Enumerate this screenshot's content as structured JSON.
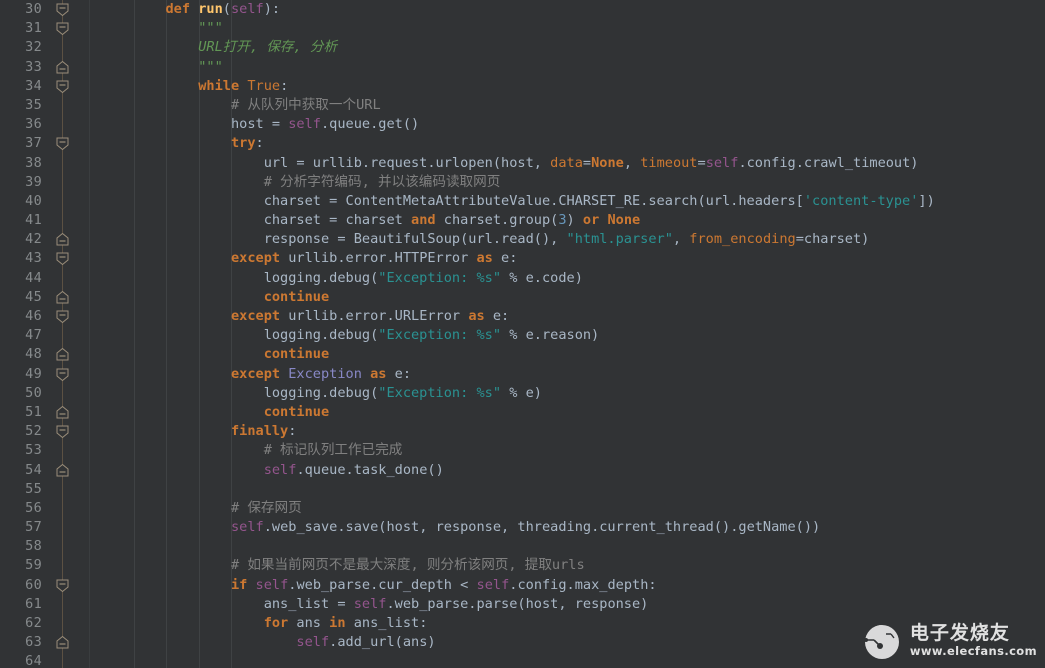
{
  "editor": {
    "language": "Python",
    "first_line_number": 30,
    "last_line_number": 64,
    "colors": {
      "background": "#313335",
      "gutter_background": "#313335",
      "line_number": "#868a8c",
      "default_text": "#a9b7c6",
      "keyword": "#cc7832",
      "function_name": "#ffc66d",
      "self_param": "#94558d",
      "string": "#2a9292",
      "number": "#6897bb",
      "comment": "#808080",
      "docstring": "#629755",
      "exception_class": "#8888c6",
      "fold_rail": "#5c5143",
      "indent_guide": "#3f4244"
    }
  },
  "lines": [
    {
      "n": 30,
      "fold": "start",
      "tokens": [
        {
          "t": "        ",
          "c": "plain"
        },
        {
          "t": "def",
          "c": "kw"
        },
        {
          "t": " ",
          "c": "plain"
        },
        {
          "t": "run",
          "c": "def"
        },
        {
          "t": "(",
          "c": "op"
        },
        {
          "t": "self",
          "c": "self"
        },
        {
          "t": "):",
          "c": "op"
        }
      ]
    },
    {
      "n": 31,
      "fold": "start",
      "tokens": [
        {
          "t": "            ",
          "c": "plain"
        },
        {
          "t": "\"\"\"",
          "c": "doc"
        }
      ]
    },
    {
      "n": 32,
      "fold": "none",
      "tokens": [
        {
          "t": "            ",
          "c": "plain"
        },
        {
          "t": "URL打开, 保存, 分析",
          "c": "doc"
        }
      ]
    },
    {
      "n": 33,
      "fold": "end",
      "tokens": [
        {
          "t": "            ",
          "c": "plain"
        },
        {
          "t": "\"\"\"",
          "c": "doc"
        }
      ]
    },
    {
      "n": 34,
      "fold": "start",
      "tokens": [
        {
          "t": "            ",
          "c": "plain"
        },
        {
          "t": "while",
          "c": "kw"
        },
        {
          "t": " ",
          "c": "plain"
        },
        {
          "t": "True",
          "c": "kw2"
        },
        {
          "t": ":",
          "c": "op"
        }
      ]
    },
    {
      "n": 35,
      "fold": "none",
      "tokens": [
        {
          "t": "                ",
          "c": "plain"
        },
        {
          "t": "# 从队列中获取一个URL",
          "c": "cmt"
        }
      ]
    },
    {
      "n": 36,
      "fold": "none",
      "tokens": [
        {
          "t": "                ",
          "c": "plain"
        },
        {
          "t": "host = ",
          "c": "plain"
        },
        {
          "t": "self",
          "c": "self"
        },
        {
          "t": ".queue.get()",
          "c": "plain"
        }
      ]
    },
    {
      "n": 37,
      "fold": "start",
      "tokens": [
        {
          "t": "                ",
          "c": "plain"
        },
        {
          "t": "try",
          "c": "kw"
        },
        {
          "t": ":",
          "c": "op"
        }
      ]
    },
    {
      "n": 38,
      "fold": "none",
      "tokens": [
        {
          "t": "                    ",
          "c": "plain"
        },
        {
          "t": "url = urllib.request.urlopen(host, ",
          "c": "plain"
        },
        {
          "t": "data",
          "c": "kw2"
        },
        {
          "t": "=",
          "c": "op"
        },
        {
          "t": "None",
          "c": "kw"
        },
        {
          "t": ", ",
          "c": "plain"
        },
        {
          "t": "timeout",
          "c": "kw2"
        },
        {
          "t": "=",
          "c": "op"
        },
        {
          "t": "self",
          "c": "self"
        },
        {
          "t": ".config.crawl_timeout)",
          "c": "plain"
        }
      ]
    },
    {
      "n": 39,
      "fold": "none",
      "tokens": [
        {
          "t": "                    ",
          "c": "plain"
        },
        {
          "t": "# 分析字符编码, 并以该编码读取网页",
          "c": "cmt"
        }
      ]
    },
    {
      "n": 40,
      "fold": "none",
      "tokens": [
        {
          "t": "                    ",
          "c": "plain"
        },
        {
          "t": "charset = ContentMetaAttributeValue.CHARSET_RE.search(url.headers[",
          "c": "plain"
        },
        {
          "t": "'content-type'",
          "c": "str"
        },
        {
          "t": "])",
          "c": "plain"
        }
      ]
    },
    {
      "n": 41,
      "fold": "none",
      "tokens": [
        {
          "t": "                    ",
          "c": "plain"
        },
        {
          "t": "charset = charset ",
          "c": "plain"
        },
        {
          "t": "and",
          "c": "kw"
        },
        {
          "t": " charset.group(",
          "c": "plain"
        },
        {
          "t": "3",
          "c": "num"
        },
        {
          "t": ") ",
          "c": "plain"
        },
        {
          "t": "or",
          "c": "kw"
        },
        {
          "t": " ",
          "c": "plain"
        },
        {
          "t": "None",
          "c": "kw"
        }
      ]
    },
    {
      "n": 42,
      "fold": "end",
      "tokens": [
        {
          "t": "                    ",
          "c": "plain"
        },
        {
          "t": "response = BeautifulSoup(url.read(), ",
          "c": "plain"
        },
        {
          "t": "\"html.parser\"",
          "c": "str"
        },
        {
          "t": ", ",
          "c": "plain"
        },
        {
          "t": "from_encoding",
          "c": "kw2"
        },
        {
          "t": "=",
          "c": "op"
        },
        {
          "t": "charset)",
          "c": "plain"
        }
      ]
    },
    {
      "n": 43,
      "fold": "start",
      "tokens": [
        {
          "t": "                ",
          "c": "plain"
        },
        {
          "t": "except",
          "c": "kw"
        },
        {
          "t": " urllib.error.HTTPError ",
          "c": "plain"
        },
        {
          "t": "as",
          "c": "kw"
        },
        {
          "t": " e:",
          "c": "plain"
        }
      ]
    },
    {
      "n": 44,
      "fold": "none",
      "tokens": [
        {
          "t": "                    ",
          "c": "plain"
        },
        {
          "t": "logging.debug(",
          "c": "plain"
        },
        {
          "t": "\"Exception: %s\"",
          "c": "str"
        },
        {
          "t": " % e.code)",
          "c": "plain"
        }
      ]
    },
    {
      "n": 45,
      "fold": "end",
      "tokens": [
        {
          "t": "                    ",
          "c": "plain"
        },
        {
          "t": "continue",
          "c": "kw"
        }
      ]
    },
    {
      "n": 46,
      "fold": "start",
      "tokens": [
        {
          "t": "                ",
          "c": "plain"
        },
        {
          "t": "except",
          "c": "kw"
        },
        {
          "t": " urllib.error.URLError ",
          "c": "plain"
        },
        {
          "t": "as",
          "c": "kw"
        },
        {
          "t": " e:",
          "c": "plain"
        }
      ]
    },
    {
      "n": 47,
      "fold": "none",
      "tokens": [
        {
          "t": "                    ",
          "c": "plain"
        },
        {
          "t": "logging.debug(",
          "c": "plain"
        },
        {
          "t": "\"Exception: %s\"",
          "c": "str"
        },
        {
          "t": " % e.reason)",
          "c": "plain"
        }
      ]
    },
    {
      "n": 48,
      "fold": "end",
      "tokens": [
        {
          "t": "                    ",
          "c": "plain"
        },
        {
          "t": "continue",
          "c": "kw"
        }
      ]
    },
    {
      "n": 49,
      "fold": "start",
      "tokens": [
        {
          "t": "                ",
          "c": "plain"
        },
        {
          "t": "except",
          "c": "kw"
        },
        {
          "t": " ",
          "c": "plain"
        },
        {
          "t": "Exception",
          "c": "excl"
        },
        {
          "t": " ",
          "c": "plain"
        },
        {
          "t": "as",
          "c": "kw"
        },
        {
          "t": " e:",
          "c": "plain"
        }
      ]
    },
    {
      "n": 50,
      "fold": "none",
      "tokens": [
        {
          "t": "                    ",
          "c": "plain"
        },
        {
          "t": "logging.debug(",
          "c": "plain"
        },
        {
          "t": "\"Exception: %s\"",
          "c": "str"
        },
        {
          "t": " % e)",
          "c": "plain"
        }
      ]
    },
    {
      "n": 51,
      "fold": "end",
      "tokens": [
        {
          "t": "                    ",
          "c": "plain"
        },
        {
          "t": "continue",
          "c": "kw"
        }
      ]
    },
    {
      "n": 52,
      "fold": "start",
      "tokens": [
        {
          "t": "                ",
          "c": "plain"
        },
        {
          "t": "finally",
          "c": "kw"
        },
        {
          "t": ":",
          "c": "op"
        }
      ]
    },
    {
      "n": 53,
      "fold": "none",
      "tokens": [
        {
          "t": "                    ",
          "c": "plain"
        },
        {
          "t": "# 标记队列工作已完成",
          "c": "cmt"
        }
      ]
    },
    {
      "n": 54,
      "fold": "end",
      "tokens": [
        {
          "t": "                    ",
          "c": "plain"
        },
        {
          "t": "self",
          "c": "self"
        },
        {
          "t": ".queue.task_done()",
          "c": "plain"
        }
      ]
    },
    {
      "n": 55,
      "fold": "none",
      "tokens": []
    },
    {
      "n": 56,
      "fold": "none",
      "tokens": [
        {
          "t": "                ",
          "c": "plain"
        },
        {
          "t": "# 保存网页",
          "c": "cmt"
        }
      ]
    },
    {
      "n": 57,
      "fold": "none",
      "tokens": [
        {
          "t": "                ",
          "c": "plain"
        },
        {
          "t": "self",
          "c": "self"
        },
        {
          "t": ".web_save.save(host, response, threading.current_thread().getName())",
          "c": "plain"
        }
      ]
    },
    {
      "n": 58,
      "fold": "none",
      "tokens": []
    },
    {
      "n": 59,
      "fold": "none",
      "tokens": [
        {
          "t": "                ",
          "c": "plain"
        },
        {
          "t": "# 如果当前网页不是最大深度, 则分析该网页, 提取urls",
          "c": "cmt"
        }
      ]
    },
    {
      "n": 60,
      "fold": "start",
      "tokens": [
        {
          "t": "                ",
          "c": "plain"
        },
        {
          "t": "if",
          "c": "kw"
        },
        {
          "t": " ",
          "c": "plain"
        },
        {
          "t": "self",
          "c": "self"
        },
        {
          "t": ".web_parse.cur_depth < ",
          "c": "plain"
        },
        {
          "t": "self",
          "c": "self"
        },
        {
          "t": ".config.max_depth:",
          "c": "plain"
        }
      ]
    },
    {
      "n": 61,
      "fold": "none",
      "tokens": [
        {
          "t": "                    ",
          "c": "plain"
        },
        {
          "t": "ans_list = ",
          "c": "plain"
        },
        {
          "t": "self",
          "c": "self"
        },
        {
          "t": ".web_parse.parse(host, response)",
          "c": "plain"
        }
      ]
    },
    {
      "n": 62,
      "fold": "none",
      "tokens": [
        {
          "t": "                    ",
          "c": "plain"
        },
        {
          "t": "for",
          "c": "kw"
        },
        {
          "t": " ans ",
          "c": "plain"
        },
        {
          "t": "in",
          "c": "kw"
        },
        {
          "t": " ans_list:",
          "c": "plain"
        }
      ]
    },
    {
      "n": 63,
      "fold": "end",
      "tokens": [
        {
          "t": "                        ",
          "c": "plain"
        },
        {
          "t": "self",
          "c": "self"
        },
        {
          "t": ".add_url(ans)",
          "c": "plain"
        }
      ]
    },
    {
      "n": 64,
      "fold": "none",
      "tokens": []
    }
  ],
  "watermark": {
    "brand_cn": "电子发烧友",
    "url": "www.elecfans.com"
  }
}
